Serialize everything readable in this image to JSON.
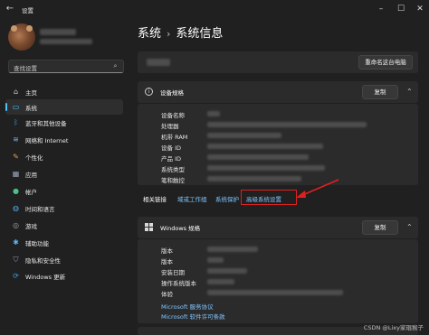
{
  "window": {
    "title": "设置"
  },
  "sidebar": {
    "search_placeholder": "查找设置",
    "items": [
      {
        "label": "主页",
        "icon": "home-icon"
      },
      {
        "label": "系统",
        "icon": "system-icon",
        "selected": true
      },
      {
        "label": "蓝牙和其他设备",
        "icon": "bluetooth-icon"
      },
      {
        "label": "网络和 Internet",
        "icon": "wifi-icon"
      },
      {
        "label": "个性化",
        "icon": "brush-icon"
      },
      {
        "label": "应用",
        "icon": "apps-icon"
      },
      {
        "label": "帐户",
        "icon": "account-icon"
      },
      {
        "label": "时间和语言",
        "icon": "globe-icon"
      },
      {
        "label": "游戏",
        "icon": "gamepad-icon"
      },
      {
        "label": "辅助功能",
        "icon": "accessibility-icon"
      },
      {
        "label": "隐私和安全性",
        "icon": "shield-icon"
      },
      {
        "label": "Windows 更新",
        "icon": "update-icon"
      }
    ]
  },
  "breadcrumb": {
    "parent": "系统",
    "separator": "›",
    "current": "系统信息"
  },
  "rename_button": "重命名这台电脑",
  "device_spec": {
    "title": "设备规格",
    "copy_button": "复制",
    "labels": [
      "设备名称",
      "处理器",
      "机带 RAM",
      "设备 ID",
      "产品 ID",
      "系统类型",
      "笔和触控"
    ]
  },
  "related_links": {
    "label": "相关链接",
    "links": [
      "域或工作组",
      "系统保护",
      "高级系统设置"
    ]
  },
  "windows_spec": {
    "title": "Windows 规格",
    "copy_button": "复制",
    "labels": [
      "版本",
      "版本",
      "安装日期",
      "操作系统版本",
      "体验"
    ],
    "links": [
      "Microsoft 服务协议",
      "Microsoft 软件许可条款"
    ]
  },
  "watermark": "CSDN @Lixy家琨猴子",
  "colors": {
    "accent": "#4cc2ff",
    "highlight": "#e02020",
    "background": "#202020",
    "card": "#2b2b2b"
  }
}
